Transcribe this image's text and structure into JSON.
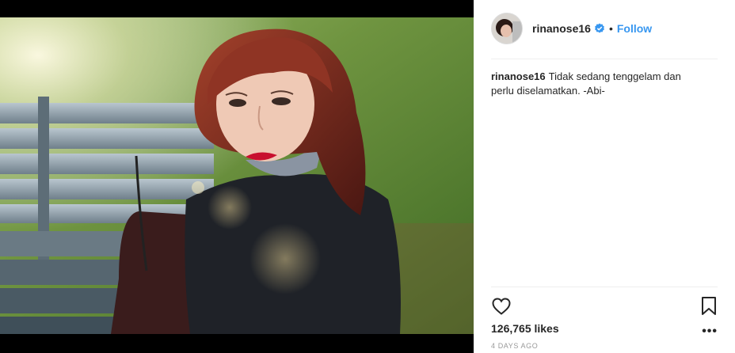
{
  "post": {
    "username": "rinanose16",
    "follow_label": "Follow",
    "separator": "•",
    "caption_user": "rinanose16",
    "caption_text": "Tidak sedang tenggelam dan perlu diselamatkan. -Abi-",
    "likes": "126,765 likes",
    "more_label": "•••",
    "timestamp": "4 DAYS AGO"
  },
  "icons": {
    "verified": "verified-badge-icon",
    "like": "heart-icon",
    "save": "bookmark-icon",
    "more": "more-options-icon"
  },
  "colors": {
    "accent": "#3897f0",
    "text": "#262626",
    "muted": "#999999",
    "lips": "#c8102e",
    "hair": "#7a2a1e"
  }
}
